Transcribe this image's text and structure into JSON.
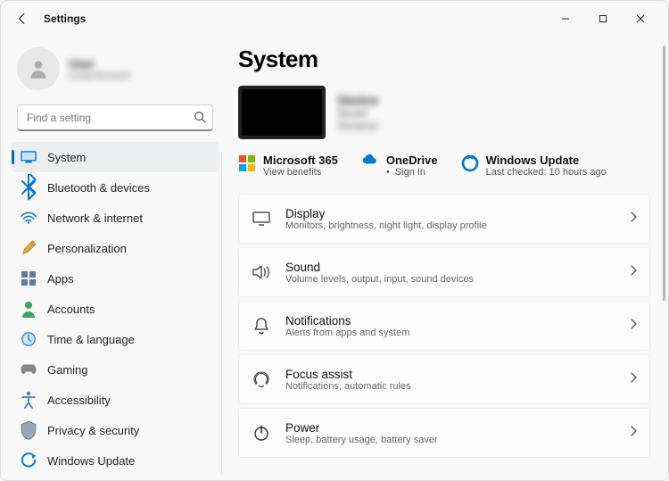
{
  "window": {
    "title": "Settings"
  },
  "user": {
    "name": "User",
    "sub": "Local Account"
  },
  "search": {
    "placeholder": "Find a setting"
  },
  "nav": [
    {
      "id": "system",
      "label": "System",
      "selected": true
    },
    {
      "id": "bluetooth",
      "label": "Bluetooth & devices"
    },
    {
      "id": "network",
      "label": "Network & internet"
    },
    {
      "id": "personalization",
      "label": "Personalization"
    },
    {
      "id": "apps",
      "label": "Apps"
    },
    {
      "id": "accounts",
      "label": "Accounts"
    },
    {
      "id": "time",
      "label": "Time & language"
    },
    {
      "id": "gaming",
      "label": "Gaming"
    },
    {
      "id": "accessibility",
      "label": "Accessibility"
    },
    {
      "id": "privacy",
      "label": "Privacy & security"
    },
    {
      "id": "windowsupdate",
      "label": "Windows Update"
    }
  ],
  "page": {
    "title": "System",
    "device": {
      "name": "Device",
      "line1": "Model",
      "line2": "Rename"
    },
    "services": {
      "m365": {
        "title": "Microsoft 365",
        "sub": "View benefits"
      },
      "onedrive": {
        "title": "OneDrive",
        "sub": "Sign In",
        "bullet": "•"
      },
      "wupdate": {
        "title": "Windows Update",
        "sub": "Last checked: 10 hours ago"
      }
    },
    "cards": [
      {
        "id": "display",
        "title": "Display",
        "sub": "Monitors, brightness, night light, display profile"
      },
      {
        "id": "sound",
        "title": "Sound",
        "sub": "Volume levels, output, input, sound devices"
      },
      {
        "id": "notifications",
        "title": "Notifications",
        "sub": "Alerts from apps and system"
      },
      {
        "id": "focus",
        "title": "Focus assist",
        "sub": "Notifications, automatic rules"
      },
      {
        "id": "power",
        "title": "Power",
        "sub": "Sleep, battery usage, battery saver"
      }
    ]
  }
}
